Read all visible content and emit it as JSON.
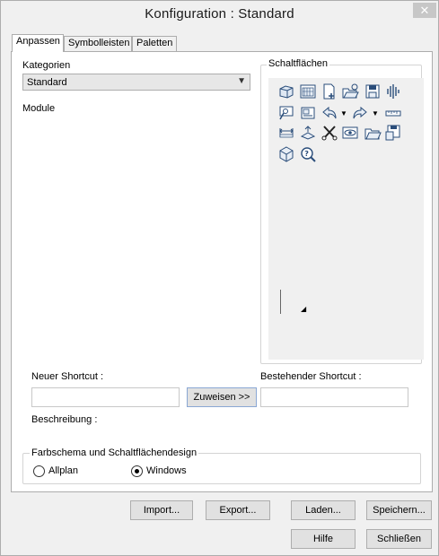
{
  "window": {
    "title": "Konfiguration :  Standard",
    "close_icon": "close-icon"
  },
  "tabs": [
    {
      "label": "Anpassen",
      "active": true
    },
    {
      "label": "Symbolleisten",
      "active": false
    },
    {
      "label": "Paletten",
      "active": false
    }
  ],
  "kategorien": {
    "label": "Kategorien",
    "selected": "Standard"
  },
  "module_label": "Module",
  "schaltflaechen": {
    "title": "Schaltflächen",
    "icons": [
      "cube-3d-icon",
      "grid-view-icon",
      "new-document-icon",
      "open-folder-icon",
      "save-disk-icon",
      "sound-wave-icon",
      "search-tool-icon",
      "image-frame-icon",
      "undo-icon",
      "redo-icon",
      "ruler-icon",
      "dimension-icon",
      "scale-icon",
      "scissors-icon",
      "eye-icon",
      "folder-open-icon",
      "save-as-icon",
      "cube-icon",
      "help-search-icon"
    ]
  },
  "shortcut": {
    "neuer_label": "Neuer Shortcut :",
    "neuer_value": "",
    "zuweisen_label": "Zuweisen >>",
    "bestehender_label": "Bestehender Shortcut :",
    "bestehender_value": "",
    "beschreibung_label": "Beschreibung :"
  },
  "design": {
    "title": "Farbschema und Schaltflächendesign",
    "options": [
      {
        "label": "Allplan",
        "selected": false
      },
      {
        "label": "Windows",
        "selected": true
      }
    ]
  },
  "buttons": {
    "import": "Import...",
    "export": "Export...",
    "laden": "Laden...",
    "speichern": "Speichern...",
    "hilfe": "Hilfe",
    "schliessen": "Schließen"
  }
}
